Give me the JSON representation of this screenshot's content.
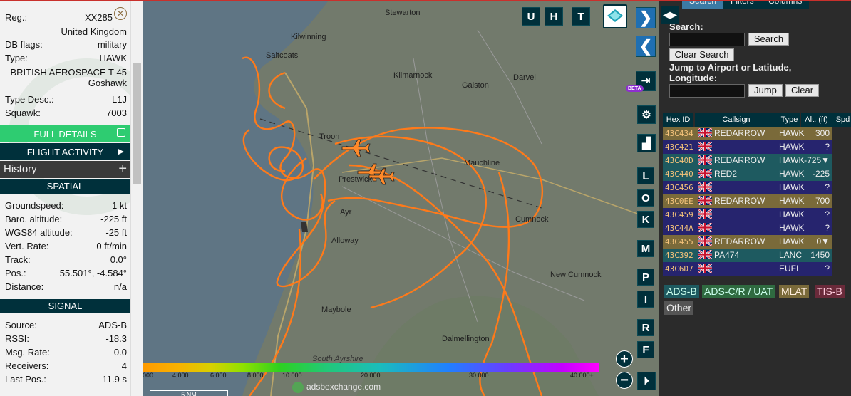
{
  "info": {
    "reg_label": "Reg.:",
    "reg_value": "XX285",
    "country": "United Kingdom",
    "db_flags_label": "DB flags:",
    "db_flags_value": "military",
    "type_label": "Type:",
    "type_value": "HAWK",
    "manufacturer_line1": "BRITISH AEROSPACE T-45",
    "manufacturer_line2": "Goshawk",
    "type_desc_label": "Type Desc.:",
    "type_desc_value": "L1J",
    "squawk_label": "Squawk:",
    "squawk_value": "7003",
    "full_details": "FULL DETAILS",
    "flight_activity": "FLIGHT ACTIVITY",
    "history": "History",
    "history_plus": "+",
    "spatial_title": "SPATIAL",
    "spatial": [
      {
        "label": "Groundspeed:",
        "value": "1 kt"
      },
      {
        "label": "Baro. altitude:",
        "value": "-225 ft"
      },
      {
        "label": "WGS84 altitude:",
        "value": "-25 ft"
      },
      {
        "label": "Vert. Rate:",
        "value": "0 ft/min"
      },
      {
        "label": "Track:",
        "value": "0.0°"
      },
      {
        "label": "Pos.:",
        "value": "55.501°, -4.584°"
      },
      {
        "label": "Distance:",
        "value": "n/a"
      }
    ],
    "signal_title": "SIGNAL",
    "signal": [
      {
        "label": "Source:",
        "value": "ADS-B"
      },
      {
        "label": "RSSI:",
        "value": "-18.3"
      },
      {
        "label": "Msg. Rate:",
        "value": "0.0"
      },
      {
        "label": "Receivers:",
        "value": "4"
      },
      {
        "label": "Last Pos.:",
        "value": "11.9 s"
      }
    ]
  },
  "map": {
    "places": [
      "Stewarton",
      "Kilwinning",
      "Saltcoats",
      "Kilmarnock",
      "Darvel",
      "Galston",
      "Troon",
      "Prestwick",
      "Mauchline",
      "Ayr",
      "Cumnock",
      "Alloway",
      "New Cumnock",
      "Maybole",
      "Dalmellington",
      "South Ayrshire"
    ],
    "top_buttons": [
      "U",
      "H",
      "T"
    ],
    "side_letters": [
      "L",
      "O",
      "K",
      "M",
      "P",
      "I",
      "R",
      "F"
    ],
    "beta": "BETA",
    "zoom_in": "+",
    "zoom_out": "−",
    "scale": "5 NM",
    "attribution": "adsbexchange.com",
    "altitude_ticks": [
      "000",
      "4 000",
      "6 000",
      "8 000",
      "10 000",
      "20 000",
      "30 000",
      "40 000+"
    ]
  },
  "panel": {
    "tabs": [
      "Search",
      "Filters",
      "Columns"
    ],
    "search_label": "Search:",
    "search_button": "Search",
    "clear_search": "Clear Search",
    "jump_label_1": "Jump to Airport or Latitude,",
    "jump_label_2": "Longitude:",
    "jump_button": "Jump",
    "clear_button": "Clear",
    "columns": [
      "Hex ID",
      "Callsign",
      "Type",
      "Alt. (ft)",
      "Spd"
    ],
    "rows": [
      {
        "hex": "43C434",
        "callsign": "REDARROW",
        "type": "HAWK",
        "alt": "300",
        "bg": "#7a6a3a"
      },
      {
        "hex": "43C421",
        "callsign": "",
        "type": "HAWK",
        "alt": "?",
        "bg": "#26246e"
      },
      {
        "hex": "43C40D",
        "callsign": "REDARROW",
        "type": "HAWK",
        "alt": "-725▼",
        "bg": "#1e5a60"
      },
      {
        "hex": "43C440",
        "callsign": "RED2",
        "type": "HAWK",
        "alt": "-225",
        "bg": "#1e5a60"
      },
      {
        "hex": "43C456",
        "callsign": "",
        "type": "HAWK",
        "alt": "?",
        "bg": "#26246e"
      },
      {
        "hex": "43C0EE",
        "callsign": "REDARROW",
        "type": "HAWK",
        "alt": "700",
        "bg": "#7a6a3a"
      },
      {
        "hex": "43C459",
        "callsign": "",
        "type": "HAWK",
        "alt": "?",
        "bg": "#26246e"
      },
      {
        "hex": "43C44A",
        "callsign": "",
        "type": "HAWK",
        "alt": "?",
        "bg": "#26246e"
      },
      {
        "hex": "43C455",
        "callsign": "REDARROW",
        "type": "HAWK",
        "alt": "0▼",
        "bg": "#7a6a3a"
      },
      {
        "hex": "43C392",
        "callsign": "PA474",
        "type": "LANC",
        "alt": "1450",
        "bg": "#1e5a60"
      },
      {
        "hex": "43C6D7",
        "callsign": "",
        "type": "EUFI",
        "alt": "?",
        "bg": "#26246e"
      }
    ],
    "sources": [
      {
        "label": "ADS-B",
        "color": "#1e5a60",
        "fg": "#cfe"
      },
      {
        "label": "ADS-C/R / UAT",
        "color": "#2f6a40",
        "fg": "#cfe"
      },
      {
        "label": "MLAT",
        "color": "#7a6a3a",
        "fg": "#fed"
      },
      {
        "label": "TIS-B",
        "color": "#6a2a3a",
        "fg": "#fcd"
      },
      {
        "label": "Other",
        "color": "#555555",
        "fg": "#eee"
      }
    ]
  }
}
